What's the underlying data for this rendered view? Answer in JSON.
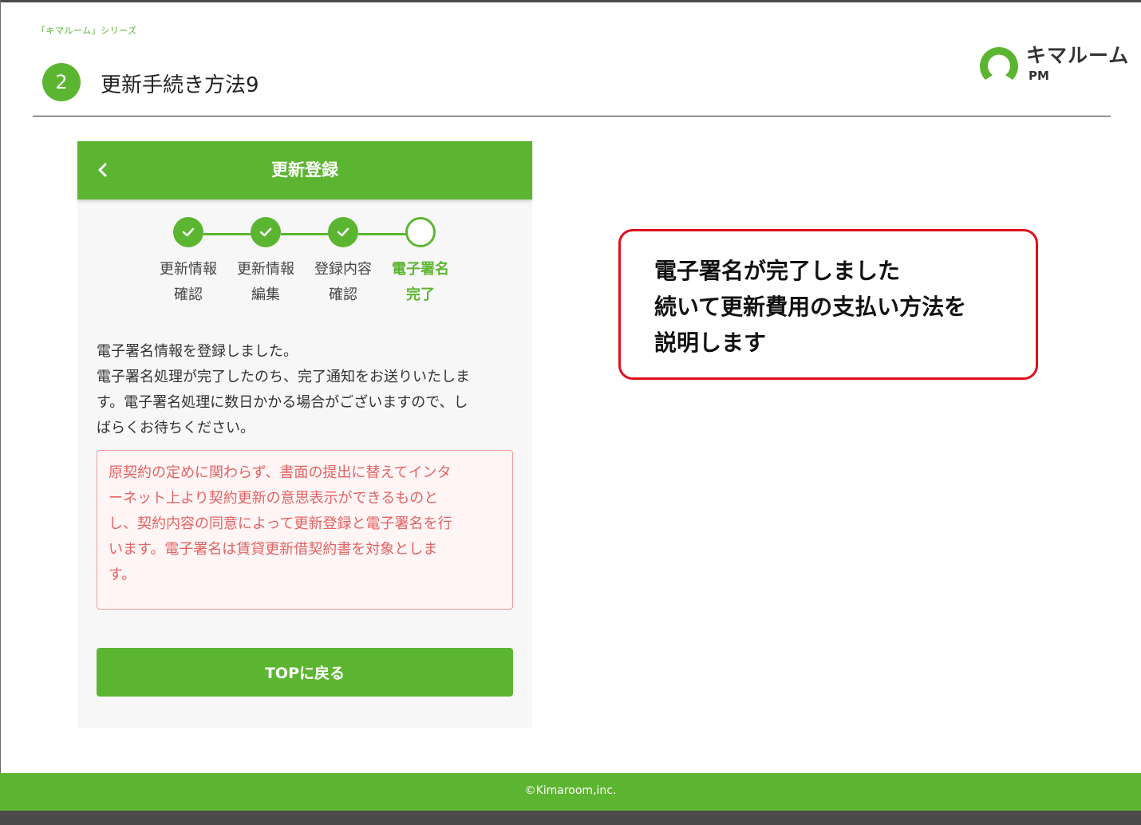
{
  "header": {
    "series_label": "「キマルーム」シリーズ",
    "step_number": "2",
    "title": "更新手続き方法9"
  },
  "logo": {
    "name": "キマルーム",
    "sub": "PM",
    "color": "#5cb531"
  },
  "app": {
    "title": "更新登録",
    "back_icon": "chevron-left-icon",
    "steps": [
      {
        "line1": "更新情報",
        "line2": "確認",
        "state": "done"
      },
      {
        "line1": "更新情報",
        "line2": "編集",
        "state": "done"
      },
      {
        "line1": "登録内容",
        "line2": "確認",
        "state": "done"
      },
      {
        "line1": "電子署名",
        "line2": "完了",
        "state": "current"
      }
    ],
    "message_lines": [
      "電子署名情報を登録しました。",
      "電子署名処理が完了したのち、完了通知をお送りいたしま",
      "す。電子署名処理に数日かかる場合がございますので、し",
      "ばらくお待ちください。"
    ],
    "notice_lines": [
      "原契約の定めに関わらず、書面の提出に替えてインタ",
      "ーネット上より契約更新の意思表示ができるものと",
      "し、契約内容の同意によって更新登録と電子署名を行",
      "います。電子署名は賃貸更新借契約書を対象としま",
      "す。"
    ],
    "top_button_label": "TOPに戻る"
  },
  "callout": {
    "lines": [
      "電子署名が完了しました",
      "続いて更新費用の支払い方法を",
      "説明します"
    ],
    "border_color": "#e0101b"
  },
  "footer": {
    "copyright": "©Kimaroom,inc."
  },
  "colors": {
    "accent": "#5cb531",
    "notice_text": "#e26363",
    "notice_border": "#ef9a9a"
  }
}
